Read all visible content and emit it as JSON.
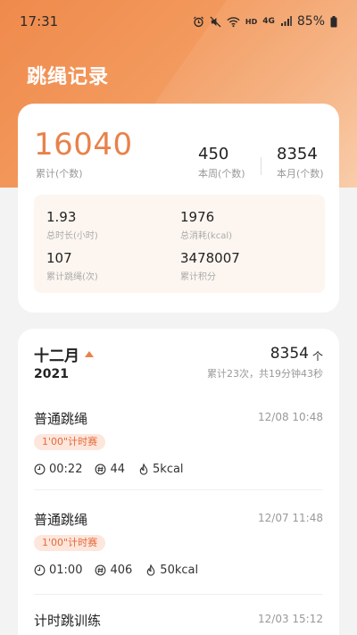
{
  "status_bar": {
    "time": "17:31",
    "hd": "HD",
    "network": "4G",
    "battery": "85%",
    "icons": [
      "alarm-icon",
      "mute-icon",
      "wifi-icon",
      "signal-icon",
      "battery-icon"
    ]
  },
  "page": {
    "title": "跳绳记录"
  },
  "summary": {
    "total_value": "16040",
    "total_label": "累计(个数)",
    "week_value": "450",
    "week_label": "本周(个数)",
    "month_value": "8354",
    "month_label": "本月(个数)",
    "duration_value": "1.93",
    "duration_label": "总时长(小时)",
    "calories_value": "1976",
    "calories_label": "总消耗(kcal)",
    "sessions_value": "107",
    "sessions_label": "累计跳绳(次)",
    "points_value": "3478007",
    "points_label": "累计积分"
  },
  "history": {
    "month": "十二月",
    "year": "2021",
    "month_total": "8354",
    "month_total_unit": "个",
    "month_summary": "累计23次，共19分钟43秒",
    "records": [
      {
        "name": "普通跳绳",
        "date": "12/08  10:48",
        "tag": "1'00\"计时赛",
        "duration": "00:22",
        "count": "44",
        "kcal": "5kcal"
      },
      {
        "name": "普通跳绳",
        "date": "12/07  11:48",
        "tag": "1'00\"计时赛",
        "duration": "01:00",
        "count": "406",
        "kcal": "50kcal"
      },
      {
        "name": "计时跳训练",
        "date": "12/03  15:12"
      }
    ]
  },
  "colors": {
    "accent": "#e8824a",
    "tag_bg": "#fde6dc",
    "tag_text": "#e56a3a"
  }
}
